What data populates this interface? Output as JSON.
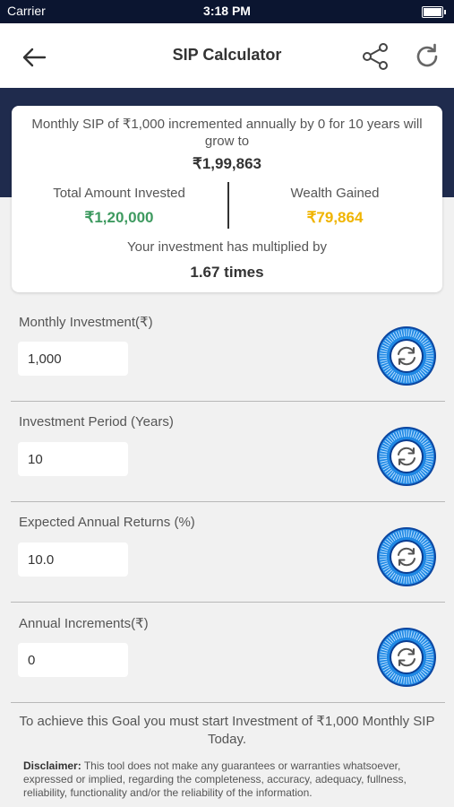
{
  "status_bar": {
    "carrier": "Carrier",
    "time": "3:18 PM"
  },
  "nav": {
    "title": "SIP Calculator"
  },
  "summary": {
    "description": "Monthly SIP of ₹1,000 incremented annually by 0 for 10 years will grow to",
    "total": "₹1,99,863",
    "invested_label": "Total Amount Invested",
    "invested_value": "₹1,20,000",
    "gained_label": "Wealth Gained",
    "gained_value": "₹79,864",
    "multiplier_label": "Your investment has multiplied by",
    "multiplier_value": "1.67 times"
  },
  "fields": [
    {
      "label": "Monthly Investment(₹)",
      "value": "1,000"
    },
    {
      "label": "Investment Period (Years)",
      "value": "10"
    },
    {
      "label": "Expected Annual Returns (%)",
      "value": "10.0"
    },
    {
      "label": "Annual Increments(₹)",
      "value": "0"
    }
  ],
  "goal_text": "To achieve this Goal you must start Investment of ₹1,000 Monthly SIP Today.",
  "disclaimer": {
    "heading": "Disclaimer:",
    "body": " This tool does not make any guarantees or warranties whatsoever, expressed or implied, regarding the completeness, accuracy, adequacy, fullness, reliability, functionality and/or the reliability of the information."
  },
  "colors": {
    "navy": "#1f2b4d",
    "invested_green": "#3e9a60",
    "gained_yellow": "#f0b400",
    "knob_blue": "#1e88e5"
  }
}
